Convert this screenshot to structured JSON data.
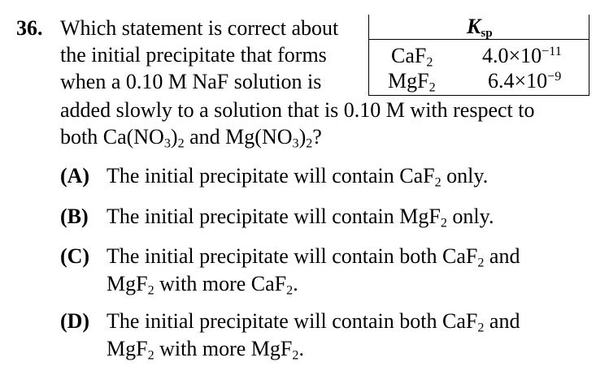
{
  "question": {
    "number": "36.",
    "stem_lines": [
      "Which statement is correct about",
      "the initial precipitate that forms",
      "when a 0.10 M NaF solution is",
      "added slowly to a solution that is 0.10 M with respect to",
      "both Ca(NO₃)₂ and Mg(NO₃)₂?"
    ]
  },
  "ksp_table": {
    "header": "Ksp",
    "rows": [
      {
        "compound": "CaF₂",
        "value": "4.0×10⁻¹¹"
      },
      {
        "compound": "MgF₂",
        "value": "6.4×10⁻⁹"
      }
    ]
  },
  "choices": [
    {
      "letter": "(A)",
      "lines": [
        "The initial precipitate will contain CaF₂ only."
      ]
    },
    {
      "letter": "(B)",
      "lines": [
        "The initial precipitate will contain MgF₂ only."
      ]
    },
    {
      "letter": "(C)",
      "lines": [
        "The initial precipitate will contain both CaF₂ and",
        "MgF₂ with more CaF₂."
      ]
    },
    {
      "letter": "(D)",
      "lines": [
        "The initial precipitate will contain both CaF₂ and",
        "MgF₂ with more MgF₂."
      ]
    }
  ]
}
